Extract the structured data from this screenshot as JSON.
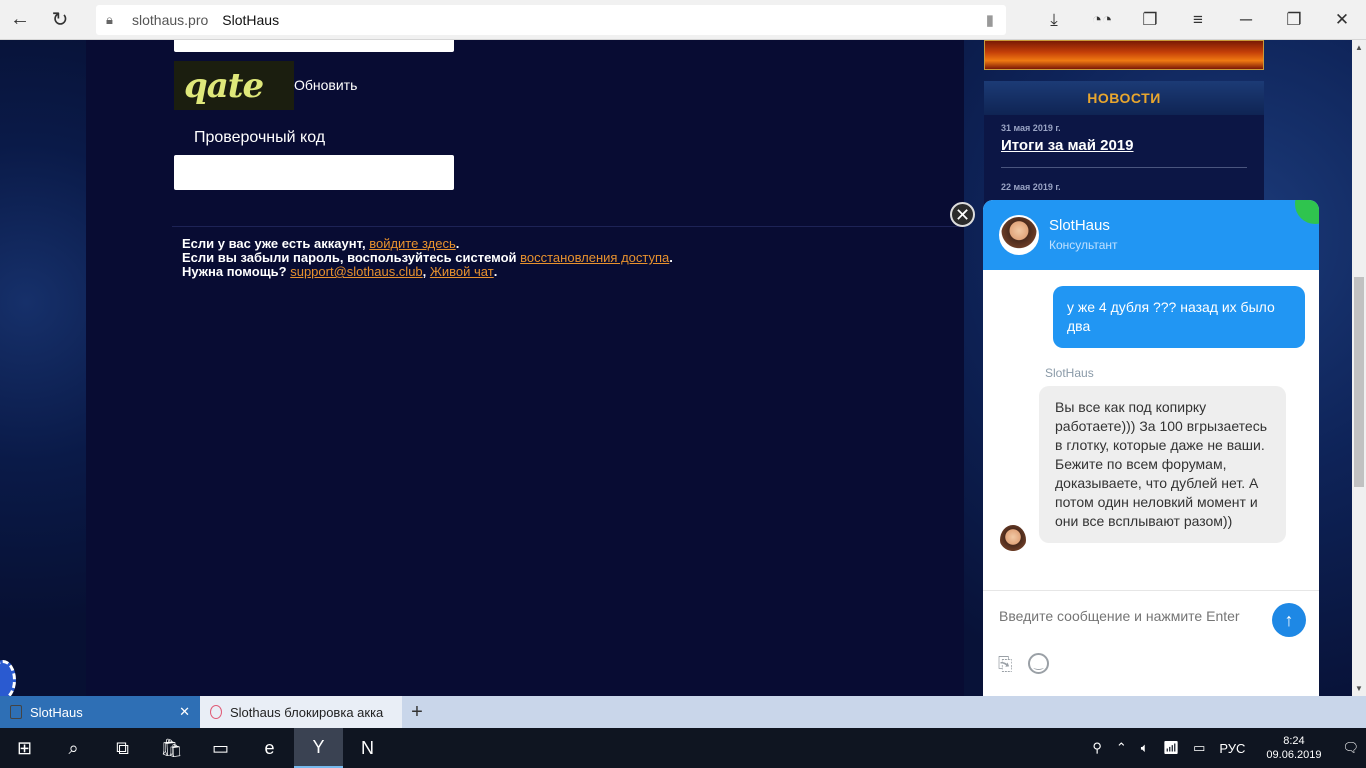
{
  "browser": {
    "domain": "slothaus.pro",
    "page_title": "SlotHaus"
  },
  "form": {
    "captcha_text": "qate",
    "refresh_label": "Обновить",
    "code_label": "Проверочный код"
  },
  "help": {
    "line1_prefix": "Если у вас уже есть аккаунт, ",
    "line1_link": "войдите здесь",
    "line1_suffix": ".",
    "line2_prefix": "Если вы забыли пароль, воспользуйтесь системой ",
    "line2_link": "восстановления доступа",
    "line2_suffix": ".",
    "line3_prefix": "Нужна помощь? ",
    "line3_link1": "support@slothaus.club",
    "line3_sep": ", ",
    "line3_link2": "Живой чат",
    "line3_suffix": "."
  },
  "news": {
    "header": "НОВОСТИ",
    "items": [
      {
        "date": "31 мая 2019 г.",
        "title": "Итоги за май 2019"
      },
      {
        "date": "22 мая 2019 г.",
        "title": ""
      }
    ]
  },
  "chat": {
    "close_label": "✕",
    "name": "SlotHaus",
    "role": "Консультант",
    "outgoing_message": "у же 4 дубля ??? назад их было два",
    "operator_name": "SlotHaus",
    "incoming_message": "Вы все как под копирку работаете))) За 100 вгрызаетесь в глотку, которые даже не ваши. Бежите по всем форумам, доказываете, что дублей нет. А потом один неловкий момент и они все всплывают разом))",
    "input_placeholder": "Введите сообщение и нажмите Enter"
  },
  "tabs": [
    {
      "label": "SlotHaus",
      "active": true
    },
    {
      "label": "Slothaus блокировка акка",
      "active": false
    }
  ],
  "taskbar": {
    "lang": "РУС",
    "time": "8:24",
    "date": "09.06.2019"
  },
  "colors": {
    "accent": "#2196f3",
    "link": "#e8922e",
    "news_header": "#e8a62e"
  }
}
